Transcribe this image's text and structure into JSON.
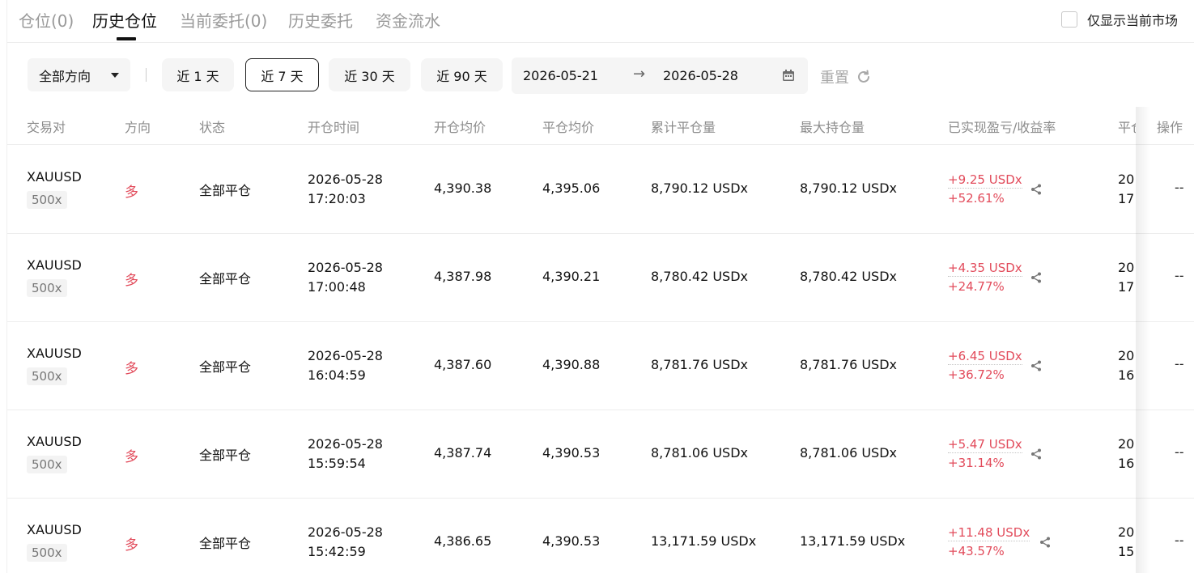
{
  "tabs": [
    {
      "label": "仓位(0)"
    },
    {
      "label": "历史仓位"
    },
    {
      "label": "当前委托(0)"
    },
    {
      "label": "历史委托"
    },
    {
      "label": "资金流水"
    }
  ],
  "only_current_label": "仅显示当前市场",
  "filters": {
    "direction": "全部方向",
    "ranges": [
      "近 1 天",
      "近 7 天",
      "近 30 天",
      "近 90 天"
    ],
    "active_range": "近 7 天",
    "date_start": "2026-05-21",
    "date_end": "2026-05-28",
    "reset_label": "重置"
  },
  "columns": [
    "交易对",
    "方向",
    "状态",
    "开仓时间",
    "开仓均价",
    "平仓均价",
    "累计平仓量",
    "最大持仓量",
    "已实现盈亏/收益率",
    "平仓时间",
    "操作"
  ],
  "rows": [
    {
      "symbol": "XAUUSD",
      "leverage": "500x",
      "side": "多",
      "status": "全部平仓",
      "open_date": "2026-05-28",
      "open_time": "17:20:03",
      "open_price": "4,390.38",
      "close_price": "4,395.06",
      "closed_qty": "8,790.12 USDx",
      "max_qty": "8,790.12 USDx",
      "pnl": "+9.25 USDx",
      "rate": "+52.61%",
      "close_date": "20",
      "close_time": "17",
      "op": "--"
    },
    {
      "symbol": "XAUUSD",
      "leverage": "500x",
      "side": "多",
      "status": "全部平仓",
      "open_date": "2026-05-28",
      "open_time": "17:00:48",
      "open_price": "4,387.98",
      "close_price": "4,390.21",
      "closed_qty": "8,780.42 USDx",
      "max_qty": "8,780.42 USDx",
      "pnl": "+4.35 USDx",
      "rate": "+24.77%",
      "close_date": "20",
      "close_time": "17",
      "op": "--"
    },
    {
      "symbol": "XAUUSD",
      "leverage": "500x",
      "side": "多",
      "status": "全部平仓",
      "open_date": "2026-05-28",
      "open_time": "16:04:59",
      "open_price": "4,387.60",
      "close_price": "4,390.88",
      "closed_qty": "8,781.76 USDx",
      "max_qty": "8,781.76 USDx",
      "pnl": "+6.45 USDx",
      "rate": "+36.72%",
      "close_date": "20",
      "close_time": "16",
      "op": "--"
    },
    {
      "symbol": "XAUUSD",
      "leverage": "500x",
      "side": "多",
      "status": "全部平仓",
      "open_date": "2026-05-28",
      "open_time": "15:59:54",
      "open_price": "4,387.74",
      "close_price": "4,390.53",
      "closed_qty": "8,781.06 USDx",
      "max_qty": "8,781.06 USDx",
      "pnl": "+5.47 USDx",
      "rate": "+31.14%",
      "close_date": "20",
      "close_time": "16",
      "op": "--"
    },
    {
      "symbol": "XAUUSD",
      "leverage": "500x",
      "side": "多",
      "status": "全部平仓",
      "open_date": "2026-05-28",
      "open_time": "15:42:59",
      "open_price": "4,386.65",
      "close_price": "4,390.53",
      "closed_qty": "13,171.59 USDx",
      "max_qty": "13,171.59 USDx",
      "pnl": "+11.48 USDx",
      "rate": "+43.57%",
      "close_date": "20",
      "close_time": "15",
      "op": "--"
    }
  ],
  "colors": {
    "profit": "#e24b5b",
    "muted": "#8c8c8c"
  }
}
